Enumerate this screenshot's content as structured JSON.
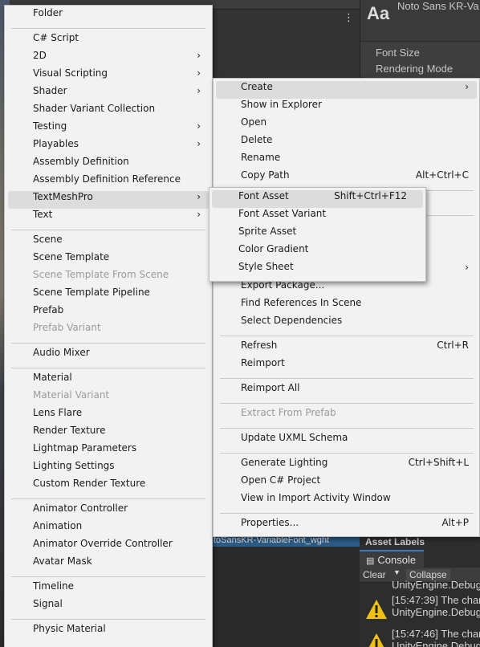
{
  "inspector": {
    "aa_label": "Aa",
    "asset_name": "Noto Sans KR-Va",
    "font_size_label": "Font Size",
    "rendering_mode_label": "Rendering Mode"
  },
  "project": {
    "selected_file": "toSansKR-VariableFont_wght",
    "more_icon": "⋮"
  },
  "asset_labels": "Asset Labels",
  "console": {
    "tab_label": "Console",
    "clear_label": "Clear",
    "collapse_label": "Collapse",
    "partial_line": "UnityEngine.Debug",
    "logs": [
      {
        "line1": "[15:47:39] The char",
        "line2": "UnityEngine.Debug"
      },
      {
        "line1": "[15:47:46] The char",
        "line2": "UnityEngine.Debug"
      }
    ]
  },
  "create_menu": {
    "items": {
      "folder": "Folder",
      "csharp_script": "C# Script",
      "two_d": "2D",
      "visual_scripting": "Visual Scripting",
      "shader": "Shader",
      "shader_variant_collection": "Shader Variant Collection",
      "testing": "Testing",
      "playables": "Playables",
      "assembly_definition": "Assembly Definition",
      "assembly_definition_reference": "Assembly Definition Reference",
      "textmeshpro": "TextMeshPro",
      "text": "Text",
      "scene": "Scene",
      "scene_template": "Scene Template",
      "scene_template_from_scene": "Scene Template From Scene",
      "scene_template_pipeline": "Scene Template Pipeline",
      "prefab": "Prefab",
      "prefab_variant": "Prefab Variant",
      "audio_mixer": "Audio Mixer",
      "material": "Material",
      "material_variant": "Material Variant",
      "lens_flare": "Lens Flare",
      "render_texture": "Render Texture",
      "lightmap_parameters": "Lightmap Parameters",
      "lighting_settings": "Lighting Settings",
      "custom_render_texture": "Custom Render Texture",
      "animator_controller": "Animator Controller",
      "animation": "Animation",
      "animator_override_controller": "Animator Override Controller",
      "avatar_mask": "Avatar Mask",
      "timeline": "Timeline",
      "signal": "Signal",
      "physic_material": "Physic Material"
    },
    "arrow": "›"
  },
  "context_menu": {
    "items": {
      "create": "Create",
      "show_in_explorer": "Show in Explorer",
      "open": "Open",
      "delete": "Delete",
      "rename": "Rename",
      "copy_path": "Copy Path",
      "export_package": "Export Package...",
      "find_references": "Find References In Scene",
      "select_dependencies": "Select Dependencies",
      "refresh": "Refresh",
      "reimport": "Reimport",
      "reimport_all": "Reimport All",
      "extract_from_prefab": "Extract From Prefab",
      "update_uxml_schema": "Update UXML Schema",
      "generate_lighting": "Generate Lighting",
      "open_csharp_project": "Open C# Project",
      "view_import_activity": "View in Import Activity Window",
      "properties": "Properties..."
    },
    "shortcuts": {
      "copy_path": "Alt+Ctrl+C",
      "refresh": "Ctrl+R",
      "generate_lighting": "Ctrl+Shift+L",
      "properties": "Alt+P"
    }
  },
  "textmeshpro_menu": {
    "items": {
      "font_asset": "Font Asset",
      "font_asset_variant": "Font Asset Variant",
      "sprite_asset": "Sprite Asset",
      "color_gradient": "Color Gradient",
      "style_sheet": "Style Sheet"
    },
    "shortcuts": {
      "font_asset": "Shift+Ctrl+F12"
    }
  },
  "colors": {
    "menu_bg": "#f2f2f2",
    "highlight": "#dcdcdc",
    "disabled_text": "#9b9b9b",
    "selection_blue": "#2c5d87",
    "warning_yellow": "#f0c20f"
  }
}
